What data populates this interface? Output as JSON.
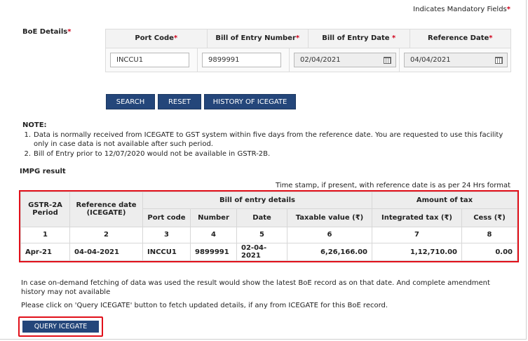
{
  "header": {
    "mandatory_text": "Indicates Mandatory Fields",
    "mandatory_mark": "*"
  },
  "boe": {
    "label": "BoE Details",
    "label_mark": "*",
    "columns": [
      {
        "label": "Port Code",
        "mark": "*"
      },
      {
        "label": "Bill of Entry Number",
        "mark": "*"
      },
      {
        "label": "Bill of Entry Date ",
        "mark": "*"
      },
      {
        "label": "Reference Date",
        "mark": "*"
      }
    ],
    "values": {
      "port_code": "INCCU1",
      "boe_number": "9899991",
      "boe_date": "02/04/2021",
      "reference_date": "04/04/2021"
    }
  },
  "buttons": {
    "search": "SEARCH",
    "reset": "RESET",
    "history": "HISTORY OF ICEGATE",
    "query": "QUERY ICEGATE"
  },
  "note": {
    "title": "NOTE:",
    "items": [
      {
        "num": "1.",
        "text": "Data is normally received from ICEGATE to GST system within five days from the reference date. You are requested to use this facility only in case data is not available after such period."
      },
      {
        "num": "2.",
        "text": "Bill of Entry prior to 12/07/2020 would not be available in GSTR-2B."
      }
    ]
  },
  "impg": {
    "title": "IMPG result",
    "timestamp_note": "Time stamp, if present, with reference date is as per 24 Hrs format",
    "headers": {
      "period": "GSTR-2A Period",
      "ref_date": "Reference date (ICEGATE)",
      "boe_details": "Bill of entry details",
      "amount_tax": "Amount of tax",
      "port_code": "Port code",
      "number": "Number",
      "date": "Date",
      "taxable": "Taxable value (₹)",
      "integrated": "Integrated tax (₹)",
      "cess": "Cess (₹)"
    },
    "index_row": [
      "1",
      "2",
      "3",
      "4",
      "5",
      "6",
      "7",
      "8"
    ],
    "row": {
      "period": "Apr-21",
      "ref_date": "04-04-2021",
      "port_code": "INCCU1",
      "number": "9899991",
      "date": "02-04-2021",
      "taxable": "6,26,166.00",
      "integrated": "1,12,710.00",
      "cess": "0.00"
    }
  },
  "footer": {
    "line1": "In case on-demand fetching of data was used the result would show the latest BoE record as on that date. And complete amendment history may not available",
    "line2": "Please click on 'Query ICEGATE' button to fetch updated details, if any from ICEGATE for this BoE record."
  },
  "icons": {
    "calendar": "calendar-icon"
  },
  "colors": {
    "button_bg": "#24467a",
    "highlight_border": "#e1101a",
    "required_mark": "#d0021b"
  }
}
